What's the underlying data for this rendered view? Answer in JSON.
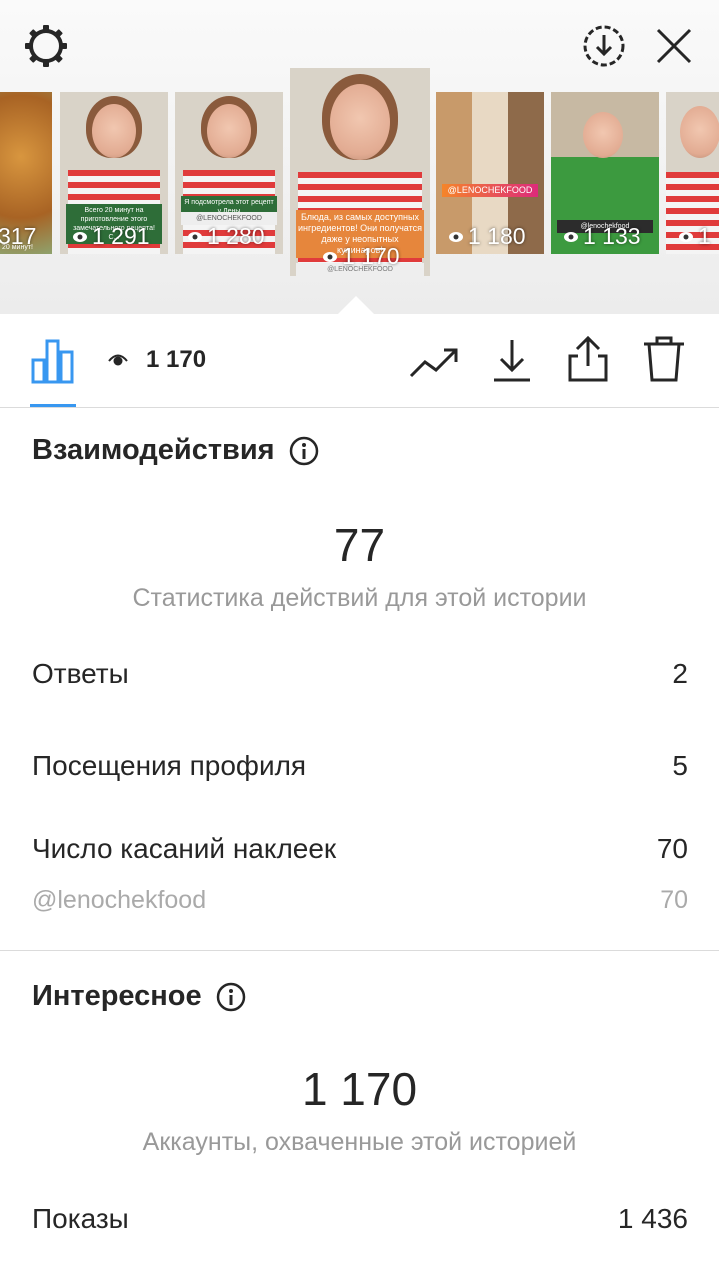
{
  "story_strip": {
    "thumbnails": [
      {
        "count": "317",
        "caption": "20 минут!"
      },
      {
        "count": "1 291",
        "caption": "Всего 20 минут на приготовление этого замечательного рецепта! С..."
      },
      {
        "count": "1 280",
        "caption": "Я подсмотрела этот рецепт у Лены",
        "tag": "@LENOCHEKFOOD"
      },
      {
        "count": "1 170",
        "caption": "Блюда, из самых доступных ингредиентов! Они получатся даже у неопытных кулинаров!",
        "tag": "@LENOCHEKFOOD",
        "selected": true
      },
      {
        "count": "1 180",
        "tag": "@LENOCHEKFOOD"
      },
      {
        "count": "1 133",
        "tag": "@lenochekfood"
      },
      {
        "count": "1"
      }
    ]
  },
  "toolbar": {
    "views": "1 170"
  },
  "interactions": {
    "title": "Взаимодействия",
    "total": "77",
    "subtitle": "Статистика действий для этой истории",
    "rows": [
      {
        "label": "Ответы",
        "value": "2"
      },
      {
        "label": "Посещения профиля",
        "value": "5"
      },
      {
        "label": "Число касаний наклеек",
        "value": "70"
      }
    ],
    "sticker_row": {
      "label": "@lenochekfood",
      "value": "70"
    }
  },
  "discovery": {
    "title": "Интересное",
    "total": "1 170",
    "subtitle": "Аккаунты, охваченные этой историей",
    "rows": [
      {
        "label": "Показы",
        "value": "1 436"
      }
    ]
  },
  "colors": {
    "accent": "#3897f0",
    "text": "#262626",
    "muted": "#999999",
    "divider": "#dbdbdb"
  },
  "icons": [
    "gear-icon",
    "download-circle-icon",
    "close-icon",
    "bar-chart-icon",
    "eye-icon",
    "trending-icon",
    "download-icon",
    "share-icon",
    "trash-icon",
    "info-icon"
  ]
}
